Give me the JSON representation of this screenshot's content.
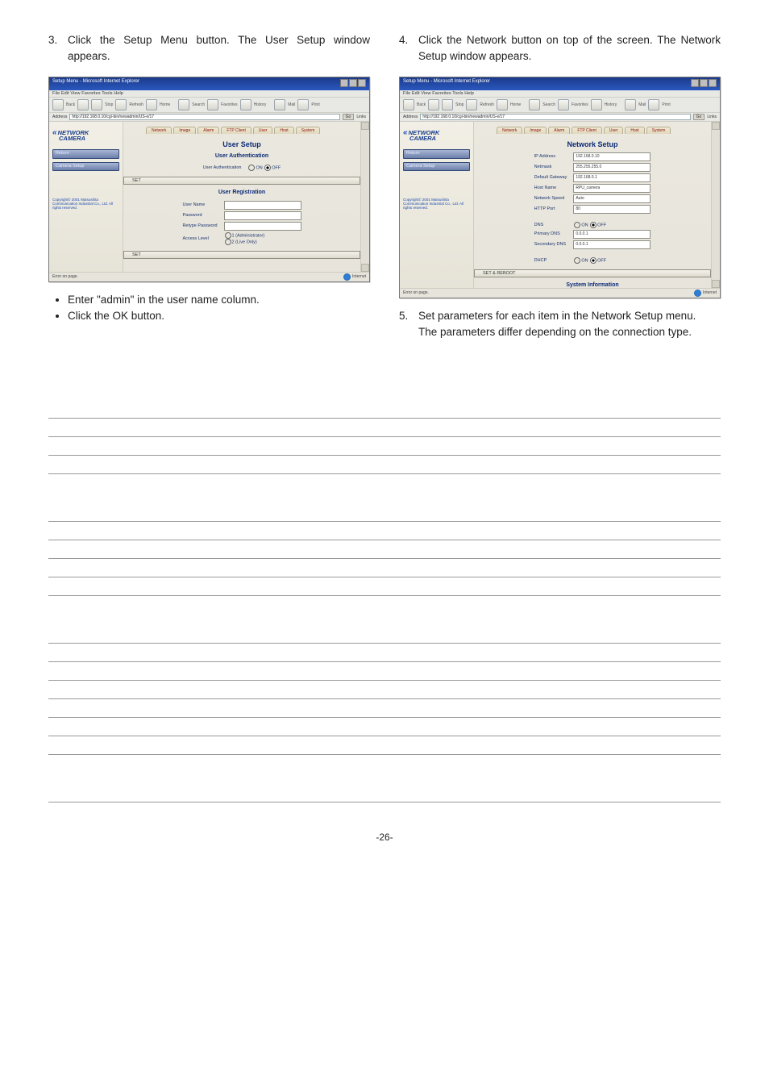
{
  "steps": {
    "s3_num": "3.",
    "s3_text": "Click the Setup Menu button. The User Setup window appears.",
    "s4_num": "4.",
    "s4_text": "Click the Network button on top of the screen. The Network Setup window appears.",
    "s5_num": "5.",
    "s5_text_a": "Set parameters for each item in the Network Setup menu.",
    "s5_text_b": "The parameters differ depending on the connection type."
  },
  "bullets": {
    "b1": "Enter \"admin\" in the user name column.",
    "b2": "Click the OK button."
  },
  "browser": {
    "title": "Setup Menu - Microsoft Internet Explorer",
    "menu": "File   Edit   View   Favorites   Tools   Help",
    "toolbar_labels": [
      "Back",
      "",
      "Stop",
      "Refresh",
      "Home",
      "Search",
      "Favorites",
      "History",
      "Mail",
      "Print"
    ],
    "address_label": "Address",
    "address_value": "http://192.168.0.10/cgi-bin/newadmin/US-e/17",
    "go": "Go",
    "links": "Links",
    "status_left": "Error on page.",
    "status_right": "Internet"
  },
  "logo": {
    "top": "NETWORK",
    "bot": "CAMERA"
  },
  "sidebar": {
    "btn_return": "Return",
    "btn_camera": "Camera Setup",
    "copyright": "Copyright© 2001 Matsushita Communication Industrial Co., Ltd.\nAll rights reserved."
  },
  "tabs": [
    "Network",
    "Image",
    "Alarm",
    "FTP Client",
    "User",
    "Host",
    "System"
  ],
  "user_setup": {
    "title": "User Setup",
    "auth_head": "User Authentication",
    "auth_label": "User Authentication",
    "reg_head": "User Registration",
    "un": "User Name",
    "pw": "Password",
    "rpw": "Retype Password",
    "al": "Access Level",
    "al_opt1": "1 (Administrator)",
    "al_opt2": "2 (Live Only)",
    "set": "SET"
  },
  "net_setup": {
    "title": "Network Setup",
    "fields": {
      "ip": "IP Address",
      "ip_v": "192.168.0.10",
      "nm": "Netmask",
      "nm_v": "255.255.255.0",
      "gw": "Default Gateway",
      "gw_v": "192.168.0.1",
      "hn": "Host Name",
      "hn_v": "RPU_camera",
      "ns": "Network Speed",
      "ns_v": "Auto",
      "hp": "HTTP Port",
      "hp_v": "80",
      "dns": "DNS",
      "pd": "Primary DNS",
      "pd_v": "0.0.0.1",
      "sd": "Secondary DNS",
      "sd_v": "0.0.0.1",
      "dhcp": "DHCP"
    },
    "onoff_on": "ON",
    "onoff_off": "OFF",
    "setreboot": "SET & REBOOT",
    "sysinfo": "System Information"
  },
  "page_number": "-26-"
}
